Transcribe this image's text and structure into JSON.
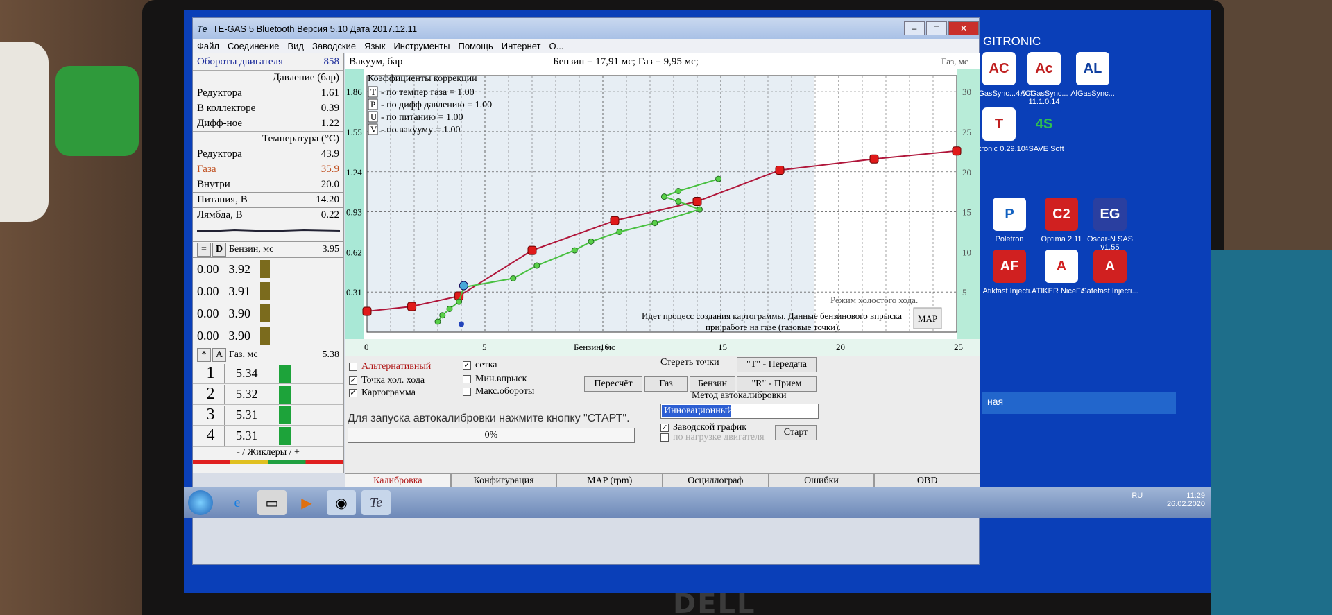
{
  "window": {
    "logo": "Te",
    "title": "TE-GAS 5 Bluetooth Версия 5.10  Дата 2017.12.11",
    "menu": [
      "Файл",
      "Соединение",
      "Вид",
      "Заводские",
      "Язык",
      "Инструменты",
      "Помощь",
      "Интернет",
      "О..."
    ]
  },
  "left": {
    "rpm_label": "Обороты двигателя",
    "rpm_value": "858",
    "pressure_header": "Давление (бар)",
    "pressure": [
      {
        "label": "Редуктора",
        "value": "1.61"
      },
      {
        "label": "В коллекторе",
        "value": "0.39"
      },
      {
        "label": "Дифф-ное",
        "value": "1.22"
      }
    ],
    "temp_header": "Температура (°C)",
    "temps": [
      {
        "label": "Редуктора",
        "value": "43.9"
      },
      {
        "label": "Газа",
        "value": "35.9"
      },
      {
        "label": "Внутри",
        "value": "20.0"
      }
    ],
    "supply_label": "Питания, В",
    "supply_value": "14.20",
    "lambda_label": "Лямбда, В",
    "lambda_value": "0.22",
    "petrol_btn1": "=",
    "petrol_btn2": "D",
    "petrol_label": "Бензин, мс",
    "petrol_value": "3.95",
    "petrol_rows": [
      {
        "a": "0.00",
        "b": "3.92"
      },
      {
        "a": "0.00",
        "b": "3.91"
      },
      {
        "a": "0.00",
        "b": "3.90"
      },
      {
        "a": "0.00",
        "b": "3.90"
      }
    ],
    "gas_btn1": "*",
    "gas_btn2": "A",
    "gas_label": "Газ, мс",
    "gas_value": "5.38",
    "gas_rows": [
      {
        "n": "1",
        "v": "5.34"
      },
      {
        "n": "2",
        "v": "5.32"
      },
      {
        "n": "3",
        "v": "5.31"
      },
      {
        "n": "4",
        "v": "5.31"
      }
    ],
    "jets_label": "- / Жиклеры / +"
  },
  "chart": {
    "left_title": "Вакуум, бар",
    "center_title": "Бензин = 17,91 мс; Газ = 9,95 мс;",
    "right_title": "Газ, мс",
    "corr_title": "Коэффициенты коррекции",
    "corrections": [
      {
        "key": "T",
        "text": "- по темпер газа = 1.00"
      },
      {
        "key": "P",
        "text": "- по дифф давлению = 1.00"
      },
      {
        "key": "U",
        "text": "- по питанию = 1.00"
      },
      {
        "key": "V",
        "text": "- по вакууму = 1.00"
      }
    ],
    "idle_text": "Режим холостого хода.",
    "process_text_1": "Идет процесс создания картограммы. Данные бензинового впрыска",
    "process_text_2": "при работе на газе (газовые точки).",
    "map_button": "MAP",
    "x_label": "Бензин, мс"
  },
  "chart_data": {
    "type": "line",
    "xlabel": "Бензин, мс",
    "ylabel": "Вакуум, бар",
    "y2label": "Газ, мс",
    "xlim": [
      0,
      25
    ],
    "x_ticks": [
      "0",
      "5",
      "10",
      "15",
      "20",
      "25"
    ],
    "y_left_ticks": [
      "0.31",
      "0.62",
      "0.93",
      "1.24",
      "1.55",
      "1.86"
    ],
    "y_right_ticks": [
      "5",
      "10",
      "15",
      "20",
      "25",
      "30"
    ],
    "grid": true,
    "series": [
      {
        "type": "line",
        "color": "#b0163a",
        "x": [
          0,
          1.9,
          3.9,
          7.0,
          10.5,
          14.0,
          17.5,
          21.5,
          25.0
        ],
        "y": [
          2.6,
          3.2,
          4.5,
          10.2,
          13.9,
          16.3,
          20.2,
          21.6,
          22.6
        ]
      },
      {
        "type": "line",
        "color": "#48c040",
        "x": [
          3.0,
          3.2,
          3.5,
          3.9,
          4.1,
          6.2,
          7.2,
          8.8,
          9.5,
          10.7,
          12.2,
          14.1,
          13.2,
          12.6,
          13.2,
          14.9
        ],
        "y": [
          1.3,
          2.1,
          2.9,
          3.8,
          5.6,
          6.7,
          8.3,
          10.2,
          11.3,
          12.5,
          13.6,
          15.3,
          16.3,
          16.9,
          17.6,
          19.1
        ]
      }
    ]
  },
  "controls": {
    "alt_label": "Альтернативный",
    "idle_point_label": "Точка хол. хода",
    "map_label": "Картограмма",
    "grid_label": "сетка",
    "min_inj_label": "Мин.впрыск",
    "max_rpm_label": "Макс.обороты",
    "erase_label": "Стереть точки",
    "recalc_btn": "Пересчёт",
    "gas_btn": "Газ",
    "petrol_btn": "Бензин",
    "transmit_btn": "\"T\" - Передача",
    "receive_btn": "\"R\" - Прием",
    "method_label": "Метод автокалибровки",
    "method_value": "Инновационный",
    "factory_graph": "Заводской график",
    "by_load": "по нагрузке двигателя",
    "start_btn": "Старт",
    "status": "Для запуска автокалибровки нажмите кнопку \"СТАРТ\".",
    "progress": "0%"
  },
  "tabs": [
    "Калибровка",
    "Конфигурация",
    "MAP (rpm)",
    "Осциллограф",
    "Ошибки",
    "OBD"
  ],
  "desktop": {
    "title": "GITRONIC",
    "icons": [
      {
        "name": "ACGasSync...4.0.4",
        "short": "AC",
        "color": "#ffffff",
        "fg": "#c02020"
      },
      {
        "name": "ACGasSync... 11.1.0.14",
        "short": "Ac",
        "color": "#ffffff",
        "fg": "#c02020"
      },
      {
        "name": "AlGasSync...",
        "short": "AL",
        "color": "#ffffff",
        "fg": "#1040a0"
      },
      {
        "name": "...tronic 0.29.10",
        "short": "T",
        "color": "#ffffff",
        "fg": "#c02020"
      },
      {
        "name": "4SAVE Soft",
        "short": "4S",
        "color": "#0a3fb8",
        "fg": "#30c050"
      },
      {
        "name": "Poletron",
        "short": "P",
        "color": "#ffffff",
        "fg": "#1060c0"
      },
      {
        "name": "Optima 2.11",
        "short": "C2",
        "color": "#d02020",
        "fg": "#ffffff"
      },
      {
        "name": "Oscar-N SAS v1.55",
        "short": "EG",
        "color": "#2a3fa0",
        "fg": "#ffffff"
      },
      {
        "name": "Atikfast Injecti...",
        "short": "AF",
        "color": "#d02020",
        "fg": "#ffffff"
      },
      {
        "name": "ATIKER NiceFa...",
        "short": "A",
        "color": "#ffffff",
        "fg": "#d02020"
      },
      {
        "name": "Safefast Injecti...",
        "short": "A",
        "color": "#d02020",
        "fg": "#ffffff"
      }
    ],
    "panel_text": "ная"
  },
  "taskbar": {
    "tray_lang": "RU",
    "time": "11:29",
    "date": "26.02.2020"
  },
  "brand": "DELL"
}
